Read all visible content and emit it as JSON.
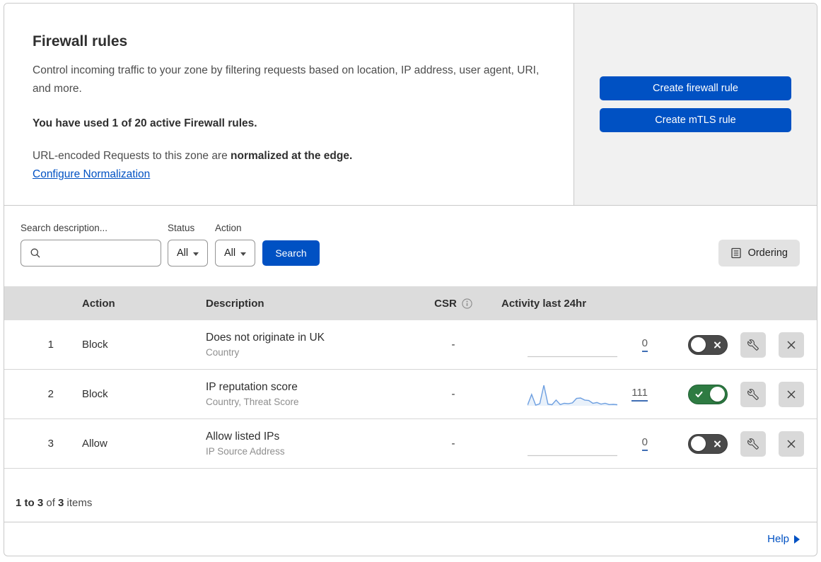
{
  "header": {
    "title": "Firewall rules",
    "description": "Control incoming traffic to your zone by filtering requests based on location, IP address, user agent, URI, and more.",
    "usage": "You have used 1 of 20 active Firewall rules.",
    "normalization_text": "URL-encoded Requests to this zone are ",
    "normalization_bold": "normalized at the edge.",
    "normalization_link": "Configure Normalization",
    "create_firewall_button": "Create firewall rule",
    "create_mtls_button": "Create mTLS rule"
  },
  "filters": {
    "search_label": "Search description...",
    "search_value": "",
    "status_label": "Status",
    "status_value": "All",
    "action_label": "Action",
    "action_value": "All",
    "search_button": "Search",
    "ordering_button": "Ordering"
  },
  "table": {
    "columns": {
      "action": "Action",
      "description": "Description",
      "csr": "CSR",
      "activity": "Activity last 24hr"
    },
    "rows": [
      {
        "priority": "1",
        "action": "Block",
        "description": "Does not originate in UK",
        "fields": "Country",
        "csr": "-",
        "activity_count": "0",
        "enabled": false,
        "sparkline": []
      },
      {
        "priority": "2",
        "action": "Block",
        "description": "IP reputation score",
        "fields": "Country, Threat Score",
        "csr": "-",
        "activity_count": "111",
        "enabled": true,
        "sparkline": [
          3,
          55,
          3,
          10,
          100,
          8,
          5,
          28,
          6,
          12,
          10,
          14,
          36,
          38,
          28,
          26,
          12,
          16,
          8,
          12,
          6,
          7,
          5
        ]
      },
      {
        "priority": "3",
        "action": "Allow",
        "description": "Allow listed IPs",
        "fields": "IP Source Address",
        "csr": "-",
        "activity_count": "0",
        "enabled": false,
        "sparkline": []
      }
    ],
    "summary": {
      "range": "1 to 3",
      "of_label": " of ",
      "total": "3",
      "items_label": " items"
    }
  },
  "footer": {
    "help": "Help"
  },
  "colors": {
    "accent_blue": "#0051c3",
    "toggle_on_green": "#2e7b42",
    "toggle_off_gray": "#4a4a4a",
    "sparkline_blue": "#6d9fe0",
    "header_gray": "#dcdcdc"
  }
}
